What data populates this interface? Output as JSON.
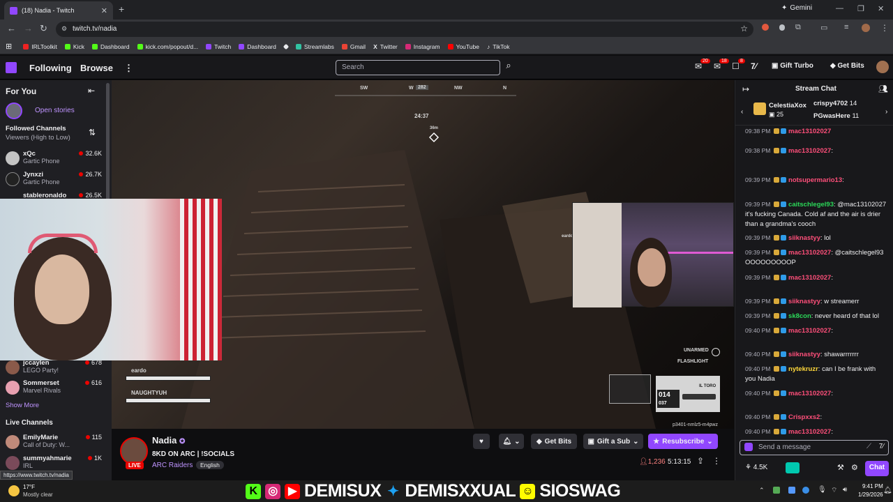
{
  "browser": {
    "tab_title": "(18) Nadia - Twitch",
    "url": "twitch.tv/nadia",
    "gemini": "Gemini",
    "status_url": "https://www.twitch.tv/nadia",
    "bookmarks": [
      "IRLToolkit",
      "Kick",
      "Dashboard",
      "kick.com/popout/d...",
      "Twitch",
      "Dashboard",
      "",
      "Streamlabs",
      "Gmail",
      "Twitter",
      "Instagram",
      "YouTube",
      "TikTok"
    ]
  },
  "twitch_nav": {
    "following": "Following",
    "browse": "Browse",
    "search_placeholder": "Search",
    "badge_1": "20",
    "badge_2": "18",
    "badge_3": "8",
    "gift_turbo": "Gift Turbo",
    "get_bits": "Get Bits"
  },
  "sidebar": {
    "for_you": "For You",
    "open_stories": "Open stories",
    "followed_channels": "Followed Channels",
    "sort": "Viewers (High to Low)",
    "channels": [
      {
        "name": "xQc",
        "game": "Gartic Phone",
        "viewers": "32.6K"
      },
      {
        "name": "Jynxzi",
        "game": "Gartic Phone",
        "viewers": "26.7K"
      },
      {
        "name": "stableronaldo",
        "game": "",
        "viewers": "26.5K"
      },
      {
        "name": "jccaylen",
        "game": "LEGO Party!",
        "viewers": "678"
      },
      {
        "name": "Sommerset",
        "game": "Marvel Rivals",
        "viewers": "616"
      }
    ],
    "show_more": "Show More",
    "live_channels": "Live Channels",
    "live": [
      {
        "name": "EmilyMarie",
        "game": "Call of Duty: W...",
        "viewers": "115"
      },
      {
        "name": "summyahmarie",
        "game": "IRL",
        "viewers": "1K"
      }
    ]
  },
  "hud": {
    "compass": [
      "SW",
      "W",
      "282",
      "NW",
      "N"
    ],
    "timer": "24:37",
    "distance": "36m",
    "player_tag": "eardo",
    "squad": [
      "eardo",
      "NAUGHTYUH"
    ],
    "unarmed": "UNARMED",
    "flashlight": "FLASHLIGHT",
    "weapon_name": "IL TORO",
    "ammo": "014",
    "ammo_reserve": "037",
    "session_id": "p3401-nmlz5-m4pwz"
  },
  "stream_info": {
    "channel": "Nadia",
    "title": "8KD ON ARC | !SOCIALS",
    "game": "ARC Raiders",
    "tag": "English",
    "live": "LIVE",
    "get_bits": "Get Bits",
    "gift_sub": "Gift a Sub",
    "resubscribe": "Resubscribe",
    "viewers": "1,236",
    "uptime": "5:13:15"
  },
  "chat": {
    "header": "Stream Chat",
    "gifters": [
      {
        "name": "CelestiaXox",
        "count": "25"
      },
      {
        "name": "crispy4702",
        "count": "14"
      },
      {
        "name": "PGwasHere",
        "count": "11"
      }
    ],
    "messages": [
      {
        "time": "09:38 PM",
        "user": "mac13102027",
        "color": "#ff4f7a",
        "text": ""
      },
      {
        "time": "09:38 PM",
        "user": "mac13102027",
        "color": "#ff4f7a",
        "text": ":"
      },
      {
        "time": "09:39 PM",
        "user": "notsupermario13",
        "color": "#ff4f7a",
        "text": ":"
      },
      {
        "time": "09:39 PM",
        "user": "caitschlegel93",
        "color": "#2bd959",
        "text": ": @mac13102027 it's fucking Canada. Cold af and the air is drier than a grandma's cooch"
      },
      {
        "time": "09:39 PM",
        "user": "siiknastyy",
        "color": "#ff4f7a",
        "text": ": lol"
      },
      {
        "time": "09:39 PM",
        "user": "mac13102027",
        "color": "#ff4f7a",
        "text": ": @caitschlegel93 OOOOOOOOOP"
      },
      {
        "time": "09:39 PM",
        "user": "mac13102027",
        "color": "#ff4f7a",
        "text": ":"
      },
      {
        "time": "09:39 PM",
        "user": "siiknastyy",
        "color": "#ff4f7a",
        "text": ": w streamerr"
      },
      {
        "time": "09:39 PM",
        "user": "sk8con",
        "color": "#2bd959",
        "text": ": never heard of that lol"
      },
      {
        "time": "09:40 PM",
        "user": "mac13102027",
        "color": "#ff4f7a",
        "text": ":"
      },
      {
        "time": "09:40 PM",
        "user": "siiknastyy",
        "color": "#ff4f7a",
        "text": ": shawarrrrrrr"
      },
      {
        "time": "09:40 PM",
        "user": "nytekruzr",
        "color": "#ffd83a",
        "text": ": can I be frank with you Nadia"
      },
      {
        "time": "09:40 PM",
        "user": "mac13102027",
        "color": "#ff4f7a",
        "text": ":"
      },
      {
        "time": "09:40 PM",
        "user": "Crispxxs2",
        "color": "#ff4f7a",
        "text": ":"
      },
      {
        "time": "09:40 PM",
        "user": "mac13102027",
        "color": "#ff4f7a",
        "text": ":"
      }
    ],
    "input_placeholder": "Send a message",
    "points": "4.5K",
    "chat_button": "Chat"
  },
  "taskbar": {
    "weather_temp": "17°F",
    "weather_desc": "Mostly clear",
    "time": "9:41 PM",
    "date": "1/29/2026",
    "banner": [
      "DEMISUX",
      "DEMISXXUAL",
      "SIOSWAG"
    ]
  }
}
